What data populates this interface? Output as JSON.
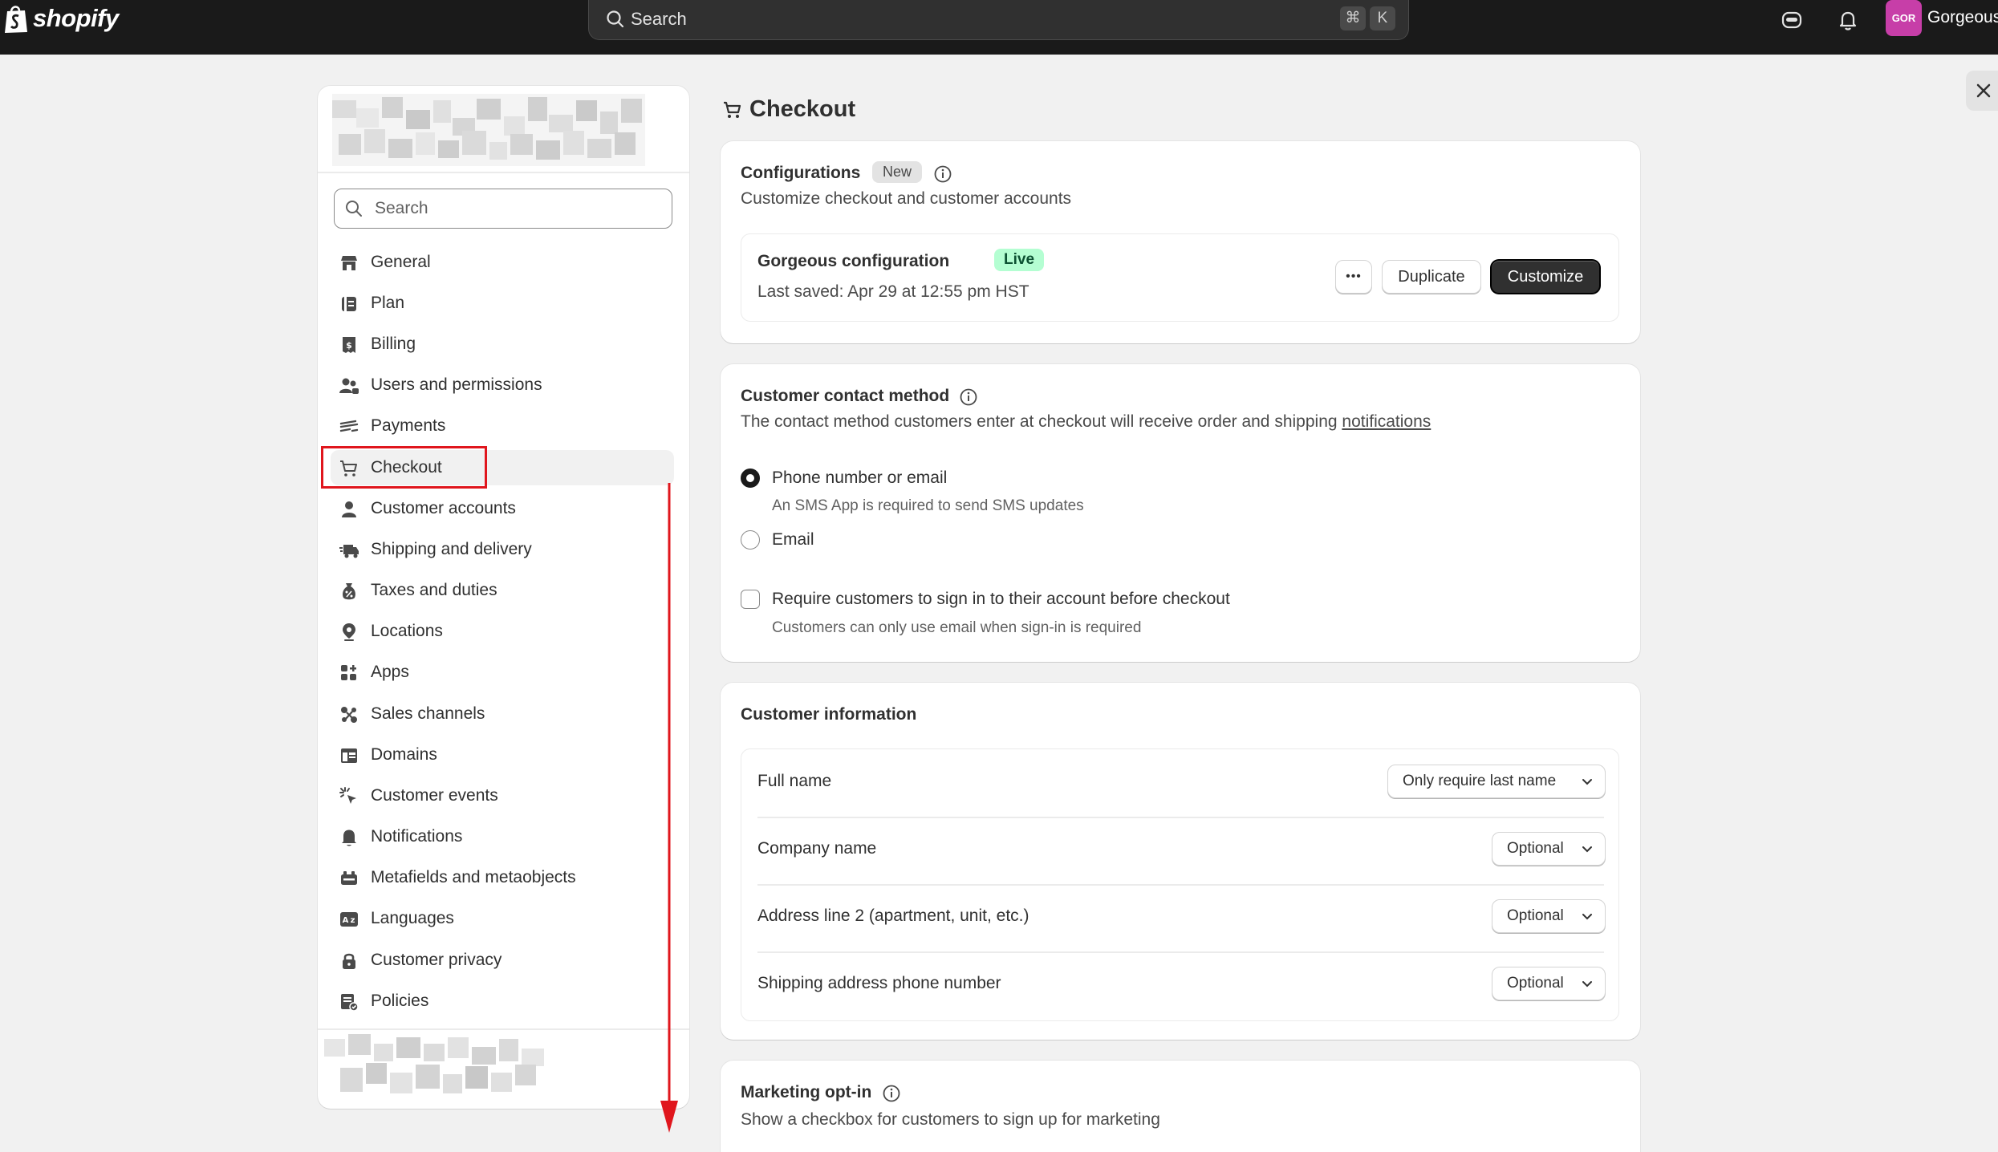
{
  "topbar": {
    "logo_text": "shopify",
    "search_placeholder": "Search",
    "shortcut_keys": [
      "⌘",
      "K"
    ],
    "avatar_initials": "GOR",
    "store_name": "Gorgeous"
  },
  "sidebar": {
    "search_placeholder": "Search",
    "items": [
      {
        "label": "General",
        "icon": "store-icon"
      },
      {
        "label": "Plan",
        "icon": "plan-icon"
      },
      {
        "label": "Billing",
        "icon": "billing-icon"
      },
      {
        "label": "Users and permissions",
        "icon": "users-icon"
      },
      {
        "label": "Payments",
        "icon": "payments-icon"
      },
      {
        "label": "Checkout",
        "icon": "cart-icon",
        "active": true
      },
      {
        "label": "Customer accounts",
        "icon": "person-icon"
      },
      {
        "label": "Shipping and delivery",
        "icon": "truck-icon"
      },
      {
        "label": "Taxes and duties",
        "icon": "tax-icon"
      },
      {
        "label": "Locations",
        "icon": "location-icon"
      },
      {
        "label": "Apps",
        "icon": "apps-icon"
      },
      {
        "label": "Sales channels",
        "icon": "channels-icon"
      },
      {
        "label": "Domains",
        "icon": "domains-icon"
      },
      {
        "label": "Customer events",
        "icon": "cursor-icon"
      },
      {
        "label": "Notifications",
        "icon": "bell-icon"
      },
      {
        "label": "Metafields and metaobjects",
        "icon": "metafields-icon"
      },
      {
        "label": "Languages",
        "icon": "language-icon"
      },
      {
        "label": "Customer privacy",
        "icon": "lock-icon"
      },
      {
        "label": "Policies",
        "icon": "policies-icon"
      }
    ]
  },
  "page": {
    "title": "Checkout"
  },
  "configurations": {
    "title": "Configurations",
    "badge": "New",
    "subtitle": "Customize checkout and customer accounts",
    "config_name": "Gorgeous configuration",
    "config_status": "Live",
    "last_saved": "Last saved: Apr 29 at 12:55 pm HST",
    "more_label": "•••",
    "duplicate_label": "Duplicate",
    "customize_label": "Customize"
  },
  "contact_method": {
    "title": "Customer contact method",
    "subtitle_prefix": "The contact method customers enter at checkout will receive order and shipping ",
    "subtitle_link": "notifications",
    "option_phone": "Phone number or email",
    "option_phone_help": "An SMS App is required to send SMS updates",
    "option_email": "Email",
    "selected": "Phone number or email",
    "require_signin": "Require customers to sign in to their account before checkout",
    "require_signin_help": "Customers can only use email when sign-in is required",
    "require_signin_checked": false
  },
  "customer_information": {
    "title": "Customer information",
    "rows": [
      {
        "label": "Full name",
        "value": "Only require last name"
      },
      {
        "label": "Company name",
        "value": "Optional"
      },
      {
        "label": "Address line 2 (apartment, unit, etc.)",
        "value": "Optional"
      },
      {
        "label": "Shipping address phone number",
        "value": "Optional"
      }
    ]
  },
  "marketing": {
    "title": "Marketing opt-in",
    "subtitle": "Show a checkbox for customers to sign up for marketing"
  }
}
